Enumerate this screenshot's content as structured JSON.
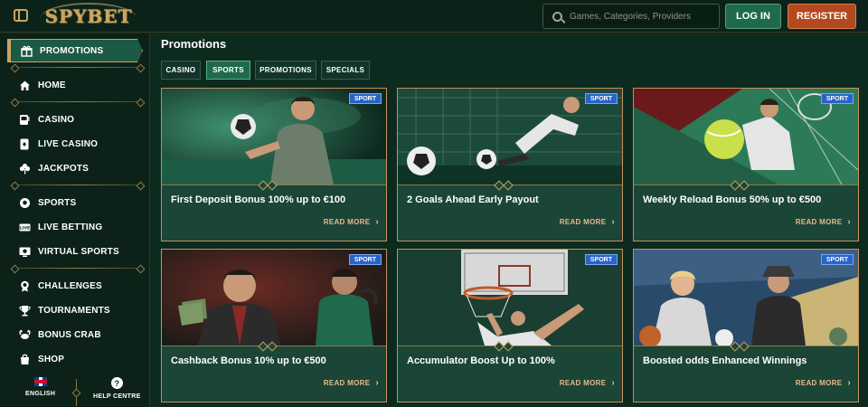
{
  "header": {
    "logo": "SPYBET",
    "search_placeholder": "Games, Categories, Providers",
    "login_label": "LOG IN",
    "register_label": "REGISTER"
  },
  "sidebar": {
    "active": "PROMOTIONS",
    "groups": [
      [
        "HOME"
      ],
      [
        "CASINO",
        "LIVE CASINO",
        "JACKPOTS"
      ],
      [
        "SPORTS",
        "LIVE BETTING",
        "VIRTUAL SPORTS"
      ],
      [
        "CHALLENGES",
        "TOURNAMENTS",
        "BONUS CRAB",
        "SHOP"
      ]
    ],
    "items": [
      "HOME",
      "CASINO",
      "LIVE CASINO",
      "JACKPOTS",
      "SPORTS",
      "LIVE BETTING",
      "VIRTUAL SPORTS",
      "CHALLENGES",
      "TOURNAMENTS",
      "BONUS CRAB",
      "SHOP"
    ],
    "footer": {
      "language": "ENGLISH",
      "help": "HELP CENTRE",
      "help_icon": "?"
    }
  },
  "main": {
    "title": "Promotions",
    "tabs": [
      "CASINO",
      "SPORTS",
      "PROMOTIONS",
      "SPECIALS"
    ],
    "active_tab": "SPORTS",
    "cards": [
      {
        "badge": "SPORT",
        "title": "First Deposit Bonus 100% up to €100",
        "cta": "READ MORE"
      },
      {
        "badge": "SPORT",
        "title": "2 Goals Ahead Early Payout",
        "cta": "READ MORE"
      },
      {
        "badge": "SPORT",
        "title": "Weekly Reload Bonus 50% up to €500",
        "cta": "READ MORE"
      },
      {
        "badge": "SPORT",
        "title": "Cashback Bonus 10% up to €500",
        "cta": "READ MORE"
      },
      {
        "badge": "SPORT",
        "title": "Accumulator Boost Up to 100%",
        "cta": "READ MORE"
      },
      {
        "badge": "SPORT",
        "title": "Boosted odds Enhanced Winnings",
        "cta": "READ MORE"
      }
    ]
  },
  "colors": {
    "background": "#0d2a1f",
    "accent_gold": "#c9a560",
    "login": "#1f6a4c",
    "register": "#b2491f",
    "badge": "#2a63c7",
    "read_more": "#e8b98a"
  },
  "icons": [
    "menu-icon",
    "search-icon",
    "gift-icon",
    "home-icon",
    "slot-machine-icon",
    "live-casino-icon",
    "clover-icon",
    "ball-icon",
    "live-icon",
    "virtual-icon",
    "challenge-icon",
    "trophy-icon",
    "crab-icon",
    "shop-icon",
    "flag-icon",
    "help-icon",
    "chevron-right-icon"
  ]
}
